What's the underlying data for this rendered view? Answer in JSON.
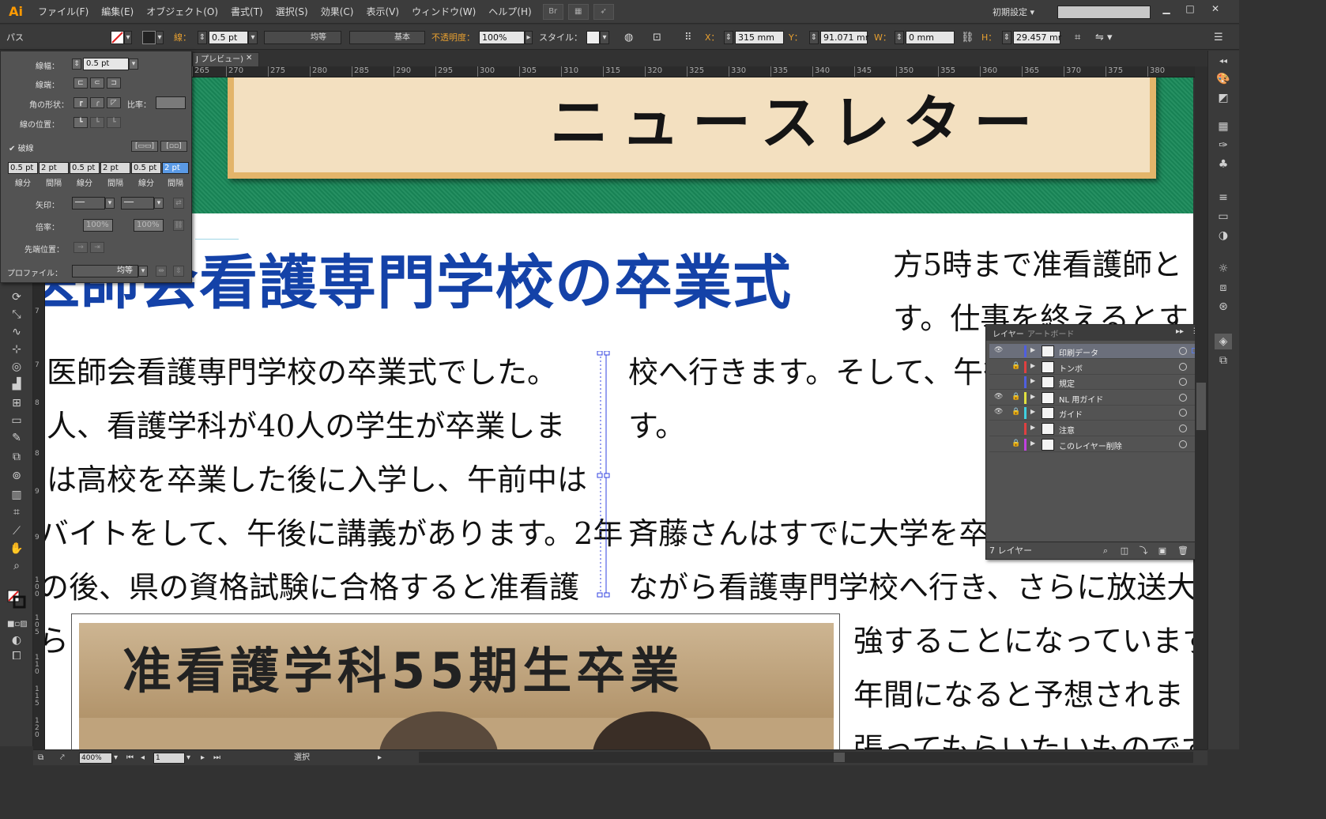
{
  "app": {
    "logo": "Ai",
    "menus": [
      "ファイル(F)",
      "編集(E)",
      "オブジェクト(O)",
      "書式(T)",
      "選択(S)",
      "効果(C)",
      "表示(V)",
      "ウィンドウ(W)",
      "ヘルプ(H)"
    ],
    "bridge_label": "Br",
    "workspace": "初期設定",
    "search_placeholder": ""
  },
  "control": {
    "object_type": "パス",
    "stroke_label": "線：",
    "stroke_value": "0.5 pt",
    "profile_label": "均等",
    "brush_label": "基本",
    "opacity_label": "不透明度：",
    "opacity_value": "100%",
    "style_label": "スタイル：",
    "x_label": "X：",
    "x_value": "315 mm",
    "y_label": "Y：",
    "y_value": "91.071 mr",
    "w_label": "W：",
    "w_value": "0 mm",
    "h_label": "H：",
    "h_value": "29.457 mr"
  },
  "stroke_panel": {
    "weight_label": "線幅：",
    "weight_value": "0.5 pt",
    "cap_label": "線端：",
    "corner_label": "角の形状：",
    "limit_label": "比率：",
    "align_label": "線の位置：",
    "dashed_label": "破線",
    "dashes": [
      "0.5 pt",
      "2 pt",
      "0.5 pt",
      "2 pt",
      "0.5 pt",
      "2 pt"
    ],
    "dash_labels": [
      "線分",
      "間隔",
      "線分",
      "間隔",
      "線分",
      "間隔"
    ],
    "arrow_label": "矢印：",
    "scale_label": "倍率：",
    "scale_start": "100%",
    "scale_end": "100%",
    "align_arrow_label": "先端位置：",
    "profile_label": "プロファイル：",
    "profile_value": "均等"
  },
  "document": {
    "tab_label": "J プレビュー)",
    "ruler_ticks": [
      "265",
      "270",
      "275",
      "280",
      "285",
      "290",
      "295",
      "300",
      "305",
      "310",
      "315",
      "320",
      "325",
      "330",
      "335",
      "340",
      "345",
      "350",
      "355",
      "360",
      "365",
      "370",
      "375",
      "380"
    ],
    "vruler_ticks": [
      "7",
      "7",
      "8",
      "8",
      "9",
      "9",
      "1 0 0",
      "1 0 5",
      "1 1 0",
      "1 1 5",
      "1 2 0"
    ]
  },
  "artwork": {
    "banner_title": "ニュースレター",
    "headline": "医師会看護専門学校の卒業式",
    "left_column": [
      "医師会看護専門学校の卒業式でした。",
      "人、看護学科が40人の学生が卒業しま",
      "は高校を卒業した後に入学し、午前中は",
      "バイトをして、午後に講義があります。2年",
      "の後、県の資格試験に合格すると准看護",
      "ら"
    ],
    "right_column": [
      "方5時まで准看護師と",
      "す。仕事を終えるとすぐ",
      "校へ行きます。そして、午後",
      "す。",
      "斉藤さんはすでに大学を卒",
      "ながら看護専門学校へ行き、さらに放送大",
      "強することになっています",
      "年間になると予想されま",
      "張ってもらいたいものです"
    ],
    "photo_banner_text": "准看護学科55期生卒業"
  },
  "layers_panel": {
    "tab_layers": "レイヤー",
    "tab_artboards": "アートボード",
    "layers": [
      {
        "name": "印刷データ",
        "visible": true,
        "locked": false,
        "color": "#4f5fe0",
        "selected": true
      },
      {
        "name": "トンボ",
        "visible": false,
        "locked": true,
        "color": "#e04040",
        "selected": false
      },
      {
        "name": "規定",
        "visible": false,
        "locked": false,
        "color": "#4f5fe0",
        "selected": false
      },
      {
        "name": "NL 用ガイド",
        "visible": true,
        "locked": true,
        "color": "#e0e040",
        "selected": false
      },
      {
        "name": "ガイド",
        "visible": true,
        "locked": true,
        "color": "#40d0e0",
        "selected": false
      },
      {
        "name": "注意",
        "visible": false,
        "locked": false,
        "color": "#e04040",
        "selected": false
      },
      {
        "name": "このレイヤー削除",
        "visible": false,
        "locked": true,
        "color": "#c040e0",
        "selected": false
      }
    ],
    "count_label": "7 レイヤー"
  },
  "status": {
    "zoom": "400%",
    "artboard_number": "1",
    "tool_name": "選択"
  }
}
